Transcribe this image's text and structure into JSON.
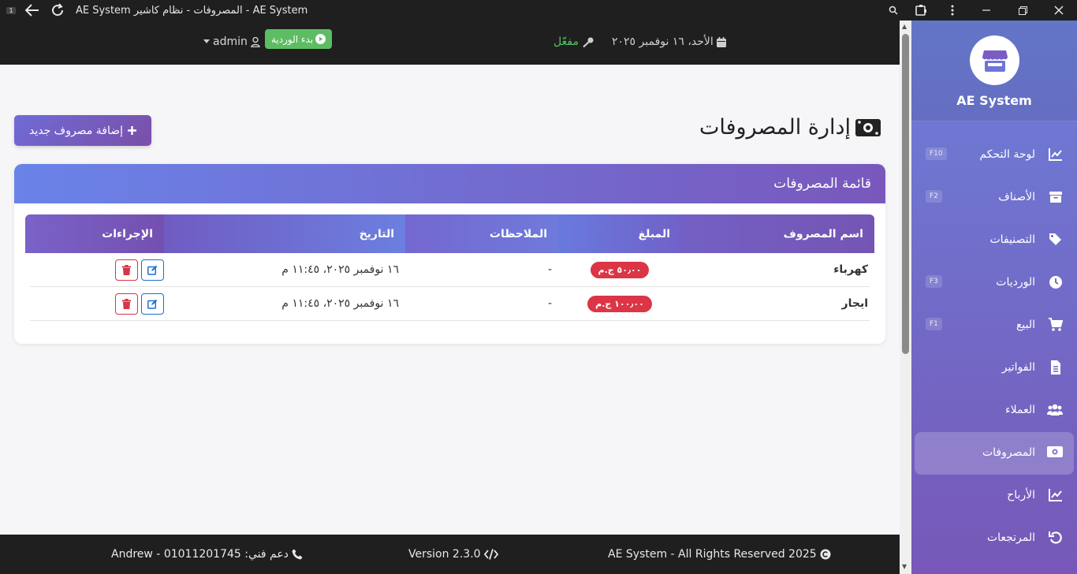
{
  "window": {
    "title": "AE System المصروفات - نظام كاشير - AE System",
    "tab_badge": "1"
  },
  "header": {
    "user": "admin",
    "shift_button": "بدء الوردية",
    "status": "مفعّل",
    "date": "الأحد، ١٦ نوفمبر ٢٠٢٥"
  },
  "page": {
    "title": "إدارة المصروفات",
    "add_button": "إضافة مصروف جديد",
    "card_title": "قائمة المصروفات"
  },
  "table": {
    "columns": [
      "اسم المصروف",
      "المبلغ",
      "الملاحظات",
      "التاريخ",
      "الإجراءات"
    ],
    "rows": [
      {
        "name": "كهرباء",
        "amount": "٥٠٫٠٠ ج.م",
        "notes": "-",
        "date": "١٦ نوفمبر ٢٠٢٥، ١١:٤٥ م"
      },
      {
        "name": "ايجار",
        "amount": "١٠٠٫٠٠ ج.م",
        "notes": "-",
        "date": "١٦ نوفمبر ٢٠٢٥، ١١:٤٥ م"
      }
    ]
  },
  "footer": {
    "copyright": "AE System - All Rights Reserved 2025",
    "version": "Version 2.3.0",
    "support": "دعم فني: 01011201745 - Andrew"
  },
  "sidebar": {
    "brand": "AE System",
    "items": [
      {
        "label": "لوحة التحكم",
        "key": "F10",
        "icon": "chart-line-icon"
      },
      {
        "label": "الأصناف",
        "key": "F2",
        "icon": "box-icon"
      },
      {
        "label": "التصنيفات",
        "key": "",
        "icon": "tags-icon"
      },
      {
        "label": "الورديات",
        "key": "F3",
        "icon": "clock-icon"
      },
      {
        "label": "البيع",
        "key": "F1",
        "icon": "cart-icon"
      },
      {
        "label": "الفواتير",
        "key": "",
        "icon": "invoice-icon"
      },
      {
        "label": "العملاء",
        "key": "",
        "icon": "users-icon"
      },
      {
        "label": "المصروفات",
        "key": "",
        "icon": "money-icon",
        "active": true
      },
      {
        "label": "الأرباح",
        "key": "",
        "icon": "chart-line-icon"
      },
      {
        "label": "المرتجعات",
        "key": "",
        "icon": "undo-icon"
      }
    ]
  },
  "colors": {
    "accent_start": "#6a83e8",
    "accent_end": "#7958bc",
    "danger": "#dc3545",
    "success": "#5cbd63"
  }
}
